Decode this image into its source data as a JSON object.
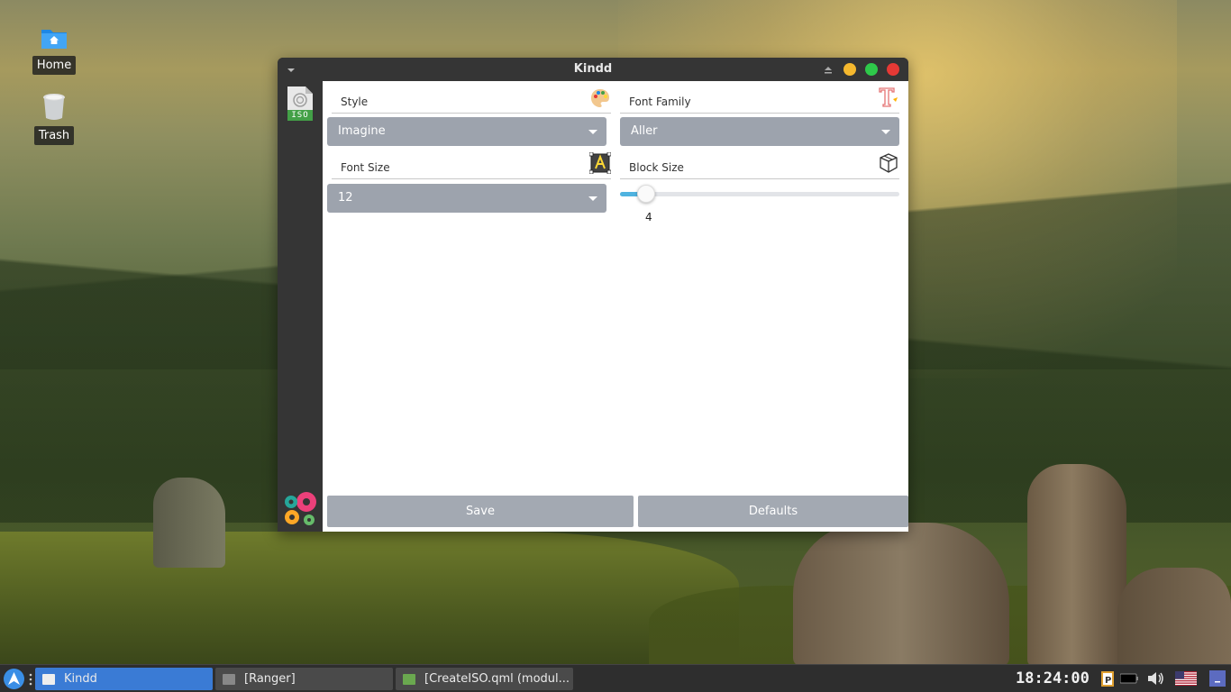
{
  "desktop": {
    "icons": [
      {
        "label": "Home"
      },
      {
        "label": "Trash"
      }
    ]
  },
  "window": {
    "title": "Kindd",
    "sidebar": {
      "iso_label": "ISO"
    },
    "settings": {
      "style": {
        "label": "Style",
        "value": "Imagine"
      },
      "font_family": {
        "label": "Font Family",
        "value": "Aller"
      },
      "font_size": {
        "label": "Font Size",
        "value": "12"
      },
      "block_size": {
        "label": "Block Size",
        "value": "4",
        "slider_fraction": 0.06
      }
    },
    "buttons": {
      "save": "Save",
      "defaults": "Defaults"
    }
  },
  "taskbar": {
    "tasks": [
      {
        "label": "Kindd",
        "active": true
      },
      {
        "label": "[Ranger]",
        "active": false
      },
      {
        "label": "[CreateISO.qml (modul...",
        "active": false
      }
    ],
    "clock": "18:24:00"
  },
  "colors": {
    "accent": "#4fb3e0",
    "task_active": "#3a7bd5",
    "combo_bg": "#9da3ad",
    "close": "#e53935",
    "minimize": "#f5b82e",
    "maximize": "#2ec94a"
  }
}
